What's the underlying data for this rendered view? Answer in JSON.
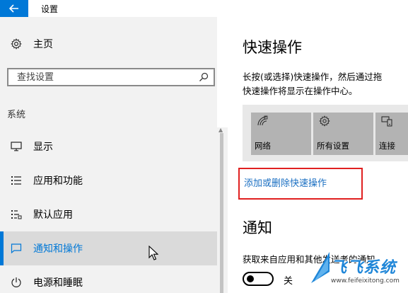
{
  "window": {
    "title": "设置"
  },
  "nav": {
    "home_label": "主页",
    "search": {
      "placeholder": "查找设置"
    },
    "group_label": "系统",
    "items": [
      {
        "label": "显示",
        "icon": "monitor-icon"
      },
      {
        "label": "应用和功能",
        "icon": "apps-list-icon"
      },
      {
        "label": "默认应用",
        "icon": "default-apps-icon"
      },
      {
        "label": "通知和操作",
        "icon": "notification-icon",
        "selected": true
      },
      {
        "label": "电源和睡眠",
        "icon": "power-icon"
      }
    ]
  },
  "main": {
    "quick_actions_title": "快速操作",
    "quick_actions_desc": [
      "长按(或选择)快速操作，然后通过拖",
      "快速操作将显示在操作中心。"
    ],
    "tiles": [
      {
        "label": "网络",
        "icon": "network-icon"
      },
      {
        "label": "所有设置",
        "icon": "gear-icon"
      },
      {
        "label": "连接",
        "icon": "connect-icon"
      }
    ],
    "edit_link": "添加或删除快速操作",
    "notifications_title": "通知",
    "notifications_desc": "获取来自应用和其他发送者的通知",
    "toggle_state": "关"
  },
  "watermark": {
    "text": "飞飞系统",
    "url": "www.feifeixitong.com"
  },
  "colors": {
    "accent": "#0078d7",
    "highlight_box": "#e02020",
    "link": "#1a6fc2",
    "nav_bg": "#f2f2f2",
    "selected_bg": "#dadada",
    "tile_bg": "#b3b3b3"
  }
}
